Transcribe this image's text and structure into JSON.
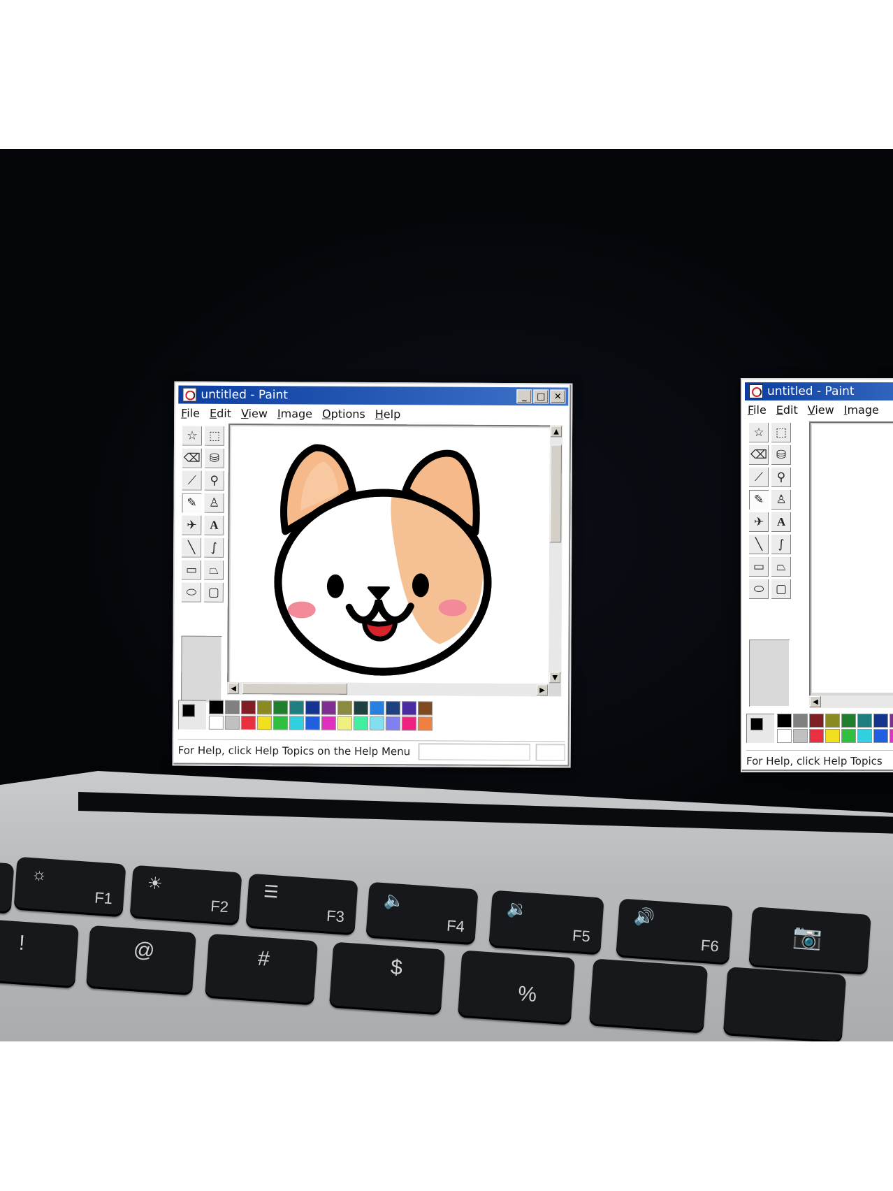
{
  "windows": [
    {
      "title": "untitled - Paint",
      "menu": [
        "File",
        "Edit",
        "View",
        "Image",
        "Options",
        "Help"
      ],
      "status_text": "For Help, click Help Topics on the Help Menu"
    },
    {
      "title": "untitled - Paint",
      "menu": [
        "File",
        "Edit",
        "View",
        "Image"
      ],
      "status_text": "For Help, click Help Topics"
    }
  ],
  "keyboard": {
    "function_keys": [
      "F1",
      "F2",
      "F3",
      "F4",
      "F5",
      "F6"
    ],
    "number_row_symbols": [
      "!",
      "@",
      "#",
      "$",
      "%"
    ]
  },
  "palette_colors": [
    "#000000",
    "#808080",
    "#7f1f24",
    "#8a8a22",
    "#1f7f2f",
    "#1f7f80",
    "#15348f",
    "#7f2f8f",
    "#8a8a40",
    "#1f4040",
    "#2a80e0",
    "#1f4080",
    "#4a2aa0",
    "#7f4a20",
    "#ffffff",
    "#c0c0c0",
    "#e83040",
    "#f0e020",
    "#30c040",
    "#30d0e0",
    "#2060e0",
    "#e030c0",
    "#f0f080",
    "#40f0a0",
    "#80e0f0",
    "#8080f0",
    "#f02080",
    "#f08040"
  ],
  "colors": {
    "title_start": "#0b3ea0",
    "title_end": "#3f72c8",
    "dog_orange": "#f5b98a",
    "cheek_pink": "#f28a9a",
    "tongue": "#d8232a"
  }
}
